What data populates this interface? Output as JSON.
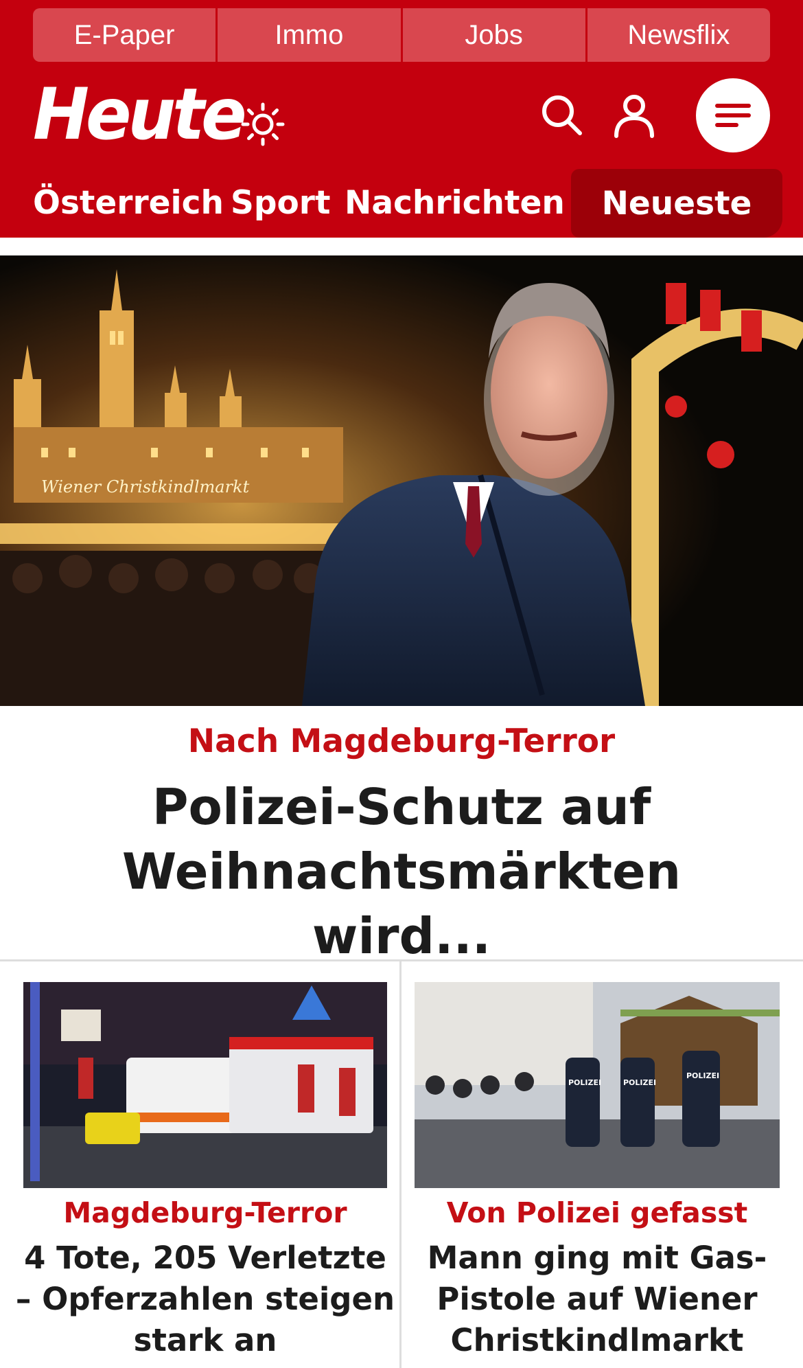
{
  "top_nav": [
    "E-Paper",
    "Immo",
    "Jobs",
    "Newsflix"
  ],
  "logo": "Heute",
  "section_nav": {
    "items": [
      "Österreich",
      "Sport",
      "Nachrichten"
    ],
    "active": "Neueste"
  },
  "icons": {
    "theme": "sun-icon",
    "search": "search-icon",
    "account": "user-icon",
    "menu": "hamburger-menu-icon"
  },
  "hero": {
    "image_sign": "Wiener Christkindlmarkt",
    "kicker": "Nach Magdeburg-Terror",
    "title": "Polizei-Schutz auf Weihnachtsmärkten wird..."
  },
  "teasers": [
    {
      "kicker": "Magdeburg-Terror",
      "title": "4 Tote, 205 Verletzte – Opferzahlen steigen stark an"
    },
    {
      "kicker": "Von Polizei gefasst",
      "title": "Mann ging mit Gas-Pistole auf Wiener Christkindlmarkt",
      "image_labels": [
        "POLIZEI",
        "POLIZEI",
        "POLIZEI"
      ]
    }
  ],
  "colors": {
    "brand_red": "#c4000e",
    "tab_bg": "#d9474f",
    "active_tab": "#9c0008",
    "kicker_red": "#c40f15",
    "headline": "#1c1c1c"
  }
}
